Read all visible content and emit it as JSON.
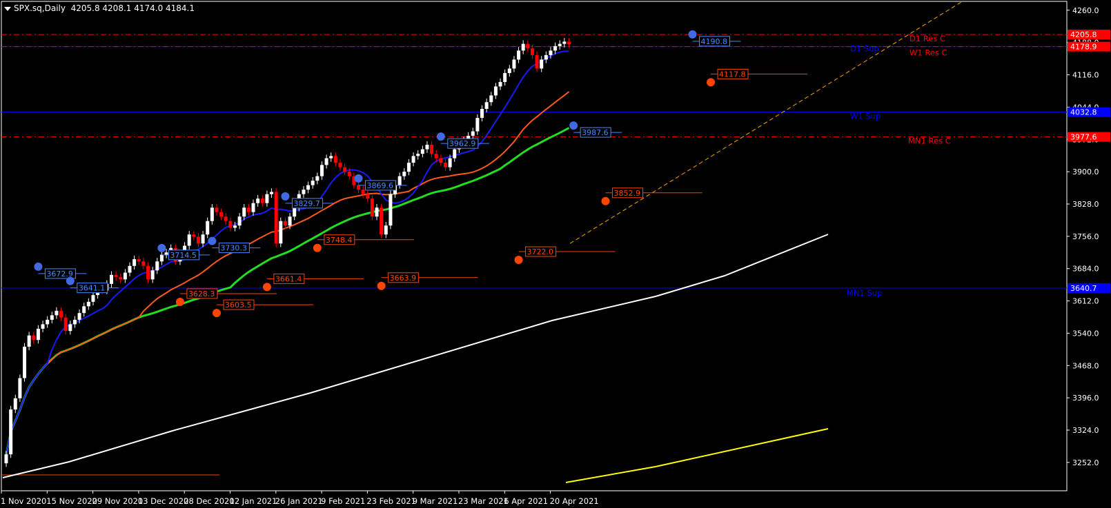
{
  "header": {
    "symbol": "SPX.sq",
    "timeframe": "Daily",
    "ohlc": "4205.8 4208.1 4174.0 4184.1"
  },
  "colors": {
    "background": "#000000",
    "bull": "#ffffff",
    "bear": "#ff0000",
    "ma_fast": "#1a1aff",
    "ma_mid": "#ff5a1a",
    "ma_slow": "#22dd22",
    "ma_long": "#ffffff",
    "ma_longest": "#ffff00",
    "swing_high": "#4169e1",
    "swing_low": "#ff4500",
    "res": "#ff0000",
    "sup": "#0000ff",
    "trend": "#ffa500"
  },
  "chart_data": {
    "type": "candlestick",
    "ylim": [
      3218,
      4272
    ],
    "price_ticks": [
      "4260.0",
      "4188.0",
      "4116.0",
      "4044.0",
      "3972.0",
      "3900.0",
      "3828.0",
      "3756.0",
      "3684.0",
      "3612.0",
      "3540.0",
      "3468.0",
      "3396.0",
      "3324.0",
      "3252.0"
    ],
    "date_ticks": [
      "1 Nov 2020",
      "15 Nov 2020",
      "29 Nov 2020",
      "13 Dec 2020",
      "28 Dec 2020",
      "12 Jan 2021",
      "26 Jan 2021",
      "9 Feb 2021",
      "23 Feb 2021",
      "9 Mar 2021",
      "23 Mar 2021",
      "6 Apr 2021",
      "20 Apr 2021"
    ],
    "date_tick_bars": [
      0,
      10,
      20,
      30,
      40,
      50,
      60,
      70,
      80,
      90,
      100,
      110,
      120
    ],
    "close_series": [
      3270,
      3370,
      3395,
      3440,
      3510,
      3535,
      3525,
      3550,
      3560,
      3570,
      3580,
      3590,
      3575,
      3545,
      3560,
      3570,
      3585,
      3600,
      3610,
      3625,
      3640,
      3635,
      3650,
      3670,
      3665,
      3660,
      3675,
      3690,
      3705,
      3700,
      3690,
      3660,
      3680,
      3700,
      3715,
      3720,
      3730,
      3700,
      3715,
      3735,
      3760,
      3755,
      3740,
      3760,
      3790,
      3820,
      3810,
      3800,
      3790,
      3775,
      3780,
      3800,
      3820,
      3810,
      3830,
      3840,
      3830,
      3850,
      3855,
      3740,
      3790,
      3780,
      3800,
      3820,
      3850,
      3860,
      3870,
      3880,
      3890,
      3915,
      3930,
      3935,
      3920,
      3910,
      3900,
      3890,
      3870,
      3860,
      3850,
      3840,
      3800,
      3820,
      3760,
      3780,
      3850,
      3870,
      3890,
      3900,
      3920,
      3935,
      3940,
      3950,
      3960,
      3940,
      3930,
      3920,
      3910,
      3930,
      3950,
      3960,
      3970,
      3980,
      3990,
      4020,
      4040,
      4055,
      4070,
      4090,
      4100,
      4120,
      4130,
      4150,
      4170,
      4185,
      4175,
      4160,
      4130,
      4150,
      4160,
      4170,
      4180,
      4185,
      4190,
      4184
    ],
    "horizontal_levels": [
      {
        "name": "D1 Res C",
        "price": 4205.8,
        "value_label": "4205.8",
        "color": "#ff0000",
        "style": "dash"
      },
      {
        "name": "D1 Sup",
        "price": 4178.9,
        "value_label": "",
        "color": "#0000ff",
        "style": "solid"
      },
      {
        "name": "W1 Res C",
        "price": 4178.9,
        "value_label": "4178.9",
        "color": "#ff0000",
        "style": "dash"
      },
      {
        "name": "W1 Sup",
        "price": 4032.8,
        "value_label": "4032.8",
        "color": "#0000ff",
        "style": "solid"
      },
      {
        "name": "MN1 Res C",
        "price": 3977.6,
        "value_label": "3977.6",
        "color": "#ff0000",
        "style": "dash"
      },
      {
        "name": "MN1 Sup",
        "price": 3640.7,
        "value_label": "3640.7",
        "color": "#0000ff",
        "style": "solid"
      }
    ],
    "swing_highs": [
      {
        "bar": 7,
        "label": "3672.9"
      },
      {
        "bar": 14,
        "label": "3641.1"
      },
      {
        "bar": 34,
        "label": "3714.5"
      },
      {
        "bar": 45,
        "label": "3730.3"
      },
      {
        "bar": 61,
        "label": "3829.7"
      },
      {
        "bar": 77,
        "label": "3869.6"
      },
      {
        "bar": 95,
        "label": "3962.9"
      },
      {
        "bar": 124,
        "label": "3987.6"
      },
      {
        "bar": 150,
        "label": "4190.8"
      }
    ],
    "swing_lows": [
      {
        "bar": 38,
        "label": "3628.3"
      },
      {
        "bar": 46,
        "label": "3603.5"
      },
      {
        "bar": 57,
        "label": "3661.4"
      },
      {
        "bar": 68,
        "label": "3748.4"
      },
      {
        "bar": 82,
        "label": "3663.9"
      },
      {
        "bar": 112,
        "label": "3722.0"
      },
      {
        "bar": 131,
        "label": "3852.9"
      },
      {
        "bar": 154,
        "label": "4117.8"
      }
    ],
    "moving_averages": [
      "ma_fast",
      "ma_mid",
      "ma_slow",
      "ma_long",
      "ma_longest"
    ]
  }
}
